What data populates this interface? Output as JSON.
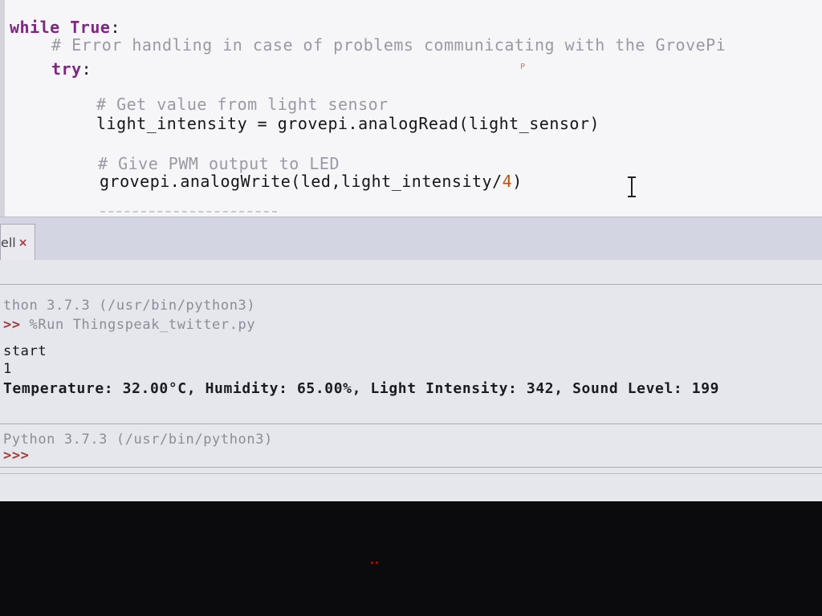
{
  "editor": {
    "lines": {
      "l1_kw_while": "while",
      "l1_kw_true": "True",
      "l1_colon": ":",
      "l2_comment": "# Error handling in case of problems communicating with the GrovePi",
      "l3_kw_try": "try",
      "l3_colon": ":",
      "l4_comment": "# Get value from light sensor",
      "l5_code": "light_intensity = grovepi.analogRead(light_sensor)",
      "l6_comment": "# Give PWM output to LED",
      "l7_code_a": "grovepi.analogWrite(led,light_intensity/",
      "l7_num": "4",
      "l7_code_b": ")"
    },
    "stray_mark": "P"
  },
  "tab": {
    "label": "ell",
    "close_glyph": "×"
  },
  "shell": {
    "first_run": {
      "banner": "thon 3.7.3 (/usr/bin/python3)",
      "prompt": ">>",
      "command": "%Run Thingspeak_twitter.py"
    },
    "output": [
      "start",
      "1",
      "Temperature: 32.00°C, Humidity: 65.00%, Light Intensity: 342, Sound Level: 199"
    ],
    "second": {
      "banner": "Python 3.7.3 (/usr/bin/python3)",
      "prompt": ">>>"
    }
  },
  "colors": {
    "keyword": "#7a2a7e",
    "comment": "#9a9aa4",
    "number": "#c05010",
    "prompt": "#a43b3b"
  }
}
